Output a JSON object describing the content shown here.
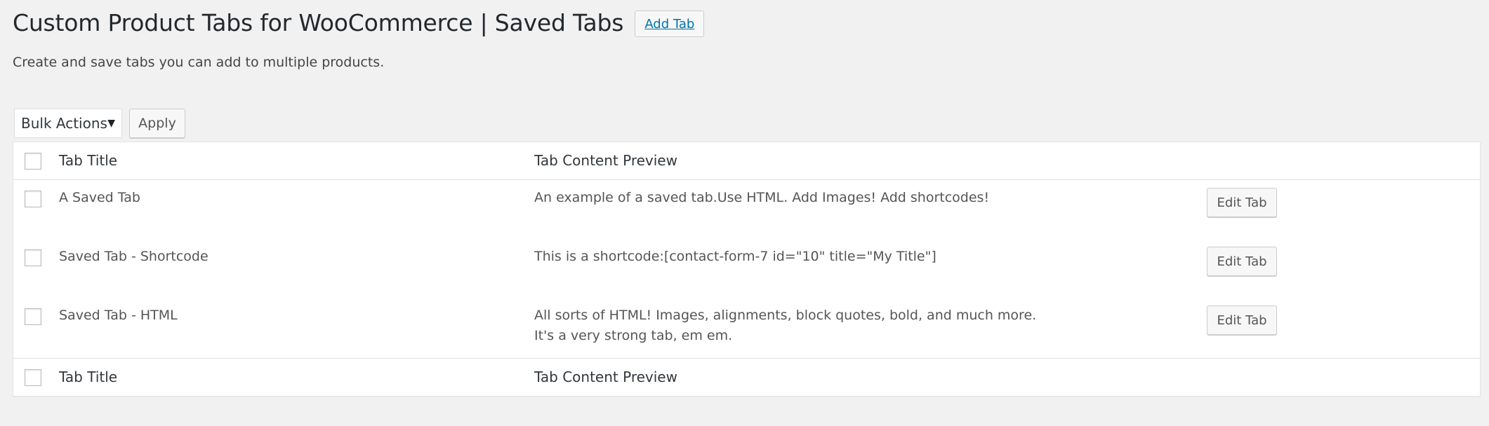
{
  "header": {
    "title": "Custom Product Tabs for WooCommerce | Saved Tabs",
    "add_button_label": "Add Tab",
    "description": "Create and save tabs you can add to multiple products."
  },
  "bulk_actions": {
    "selected": "Bulk Actions",
    "caret_icon": "▼",
    "apply_label": "Apply"
  },
  "table": {
    "columns": {
      "title": "Tab Title",
      "preview": "Tab Content Preview"
    },
    "rows": [
      {
        "title": "A Saved Tab",
        "preview_lines": [
          "An example of a saved tab.Use HTML. Add Images! Add shortcodes!"
        ],
        "action_label": "Edit Tab"
      },
      {
        "title": "Saved Tab - Shortcode",
        "preview_lines": [
          "This is a shortcode:[contact-form-7 id=\"10\" title=\"My Title\"]"
        ],
        "action_label": "Edit Tab"
      },
      {
        "title": "Saved Tab - HTML",
        "preview_lines": [
          "All sorts of HTML! Images, alignments, block quotes, bold, and much more.",
          "It's a very strong tab, em em."
        ],
        "action_label": "Edit Tab"
      }
    ]
  },
  "colors": {
    "background": "#f1f1f1",
    "link": "#0073aa",
    "text": "#444444",
    "title": "#23282d"
  }
}
